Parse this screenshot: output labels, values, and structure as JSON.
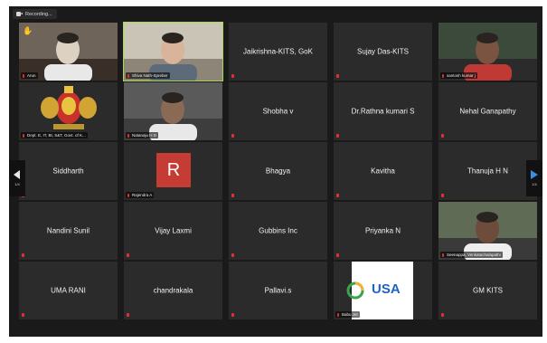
{
  "recording": {
    "label": "Recording..."
  },
  "nav": {
    "left_page": "1/4",
    "right_page": "1/4"
  },
  "participants": [
    {
      "name": "Arun",
      "type": "video"
    },
    {
      "name": "Shiva Nath-Spreber",
      "type": "video",
      "active": true
    },
    {
      "name": "Jaikrishna-KITS, GoK",
      "type": "name"
    },
    {
      "name": "Sujay Das-KITS",
      "type": "name"
    },
    {
      "name": "santosh kumar j",
      "type": "video"
    },
    {
      "name": "Dept. E, IT, Bt, S&T, Govt. of K...",
      "type": "emblem"
    },
    {
      "name": "Natanaju H D",
      "type": "video"
    },
    {
      "name": "Shobha v",
      "type": "name"
    },
    {
      "name": "Dr.Rathna kumari S",
      "type": "name"
    },
    {
      "name": "Nehal Ganapathy",
      "type": "name"
    },
    {
      "name": "Siddharth",
      "type": "name"
    },
    {
      "name": "Rajendra A",
      "type": "avatar",
      "avatar_letter": "R",
      "avatar_color": "#c43c33"
    },
    {
      "name": "Bhagya",
      "type": "name"
    },
    {
      "name": "Kavitha",
      "type": "name"
    },
    {
      "name": "Thanuja H N",
      "type": "name"
    },
    {
      "name": "Nandini Sunil",
      "type": "name"
    },
    {
      "name": "Vijay Laxmi",
      "type": "name"
    },
    {
      "name": "Gubbins Inc",
      "type": "name"
    },
    {
      "name": "Priyanka N",
      "type": "name"
    },
    {
      "name": "Seenappa, Venkatachalapathi",
      "type": "video"
    },
    {
      "name": "UMA RANI",
      "type": "name"
    },
    {
      "name": "chandrakala",
      "type": "name"
    },
    {
      "name": "Pallavi.s",
      "type": "name"
    },
    {
      "name": "Babu Jer",
      "type": "logo",
      "logo_text": "USA"
    },
    {
      "name": "GM KITS",
      "type": "name"
    }
  ],
  "colors": {
    "active_border": "#a8d95a",
    "tile_bg": "#2b2b2b",
    "app_bg": "#1a1a1a",
    "nav_arrow": "#3a8ee6"
  }
}
